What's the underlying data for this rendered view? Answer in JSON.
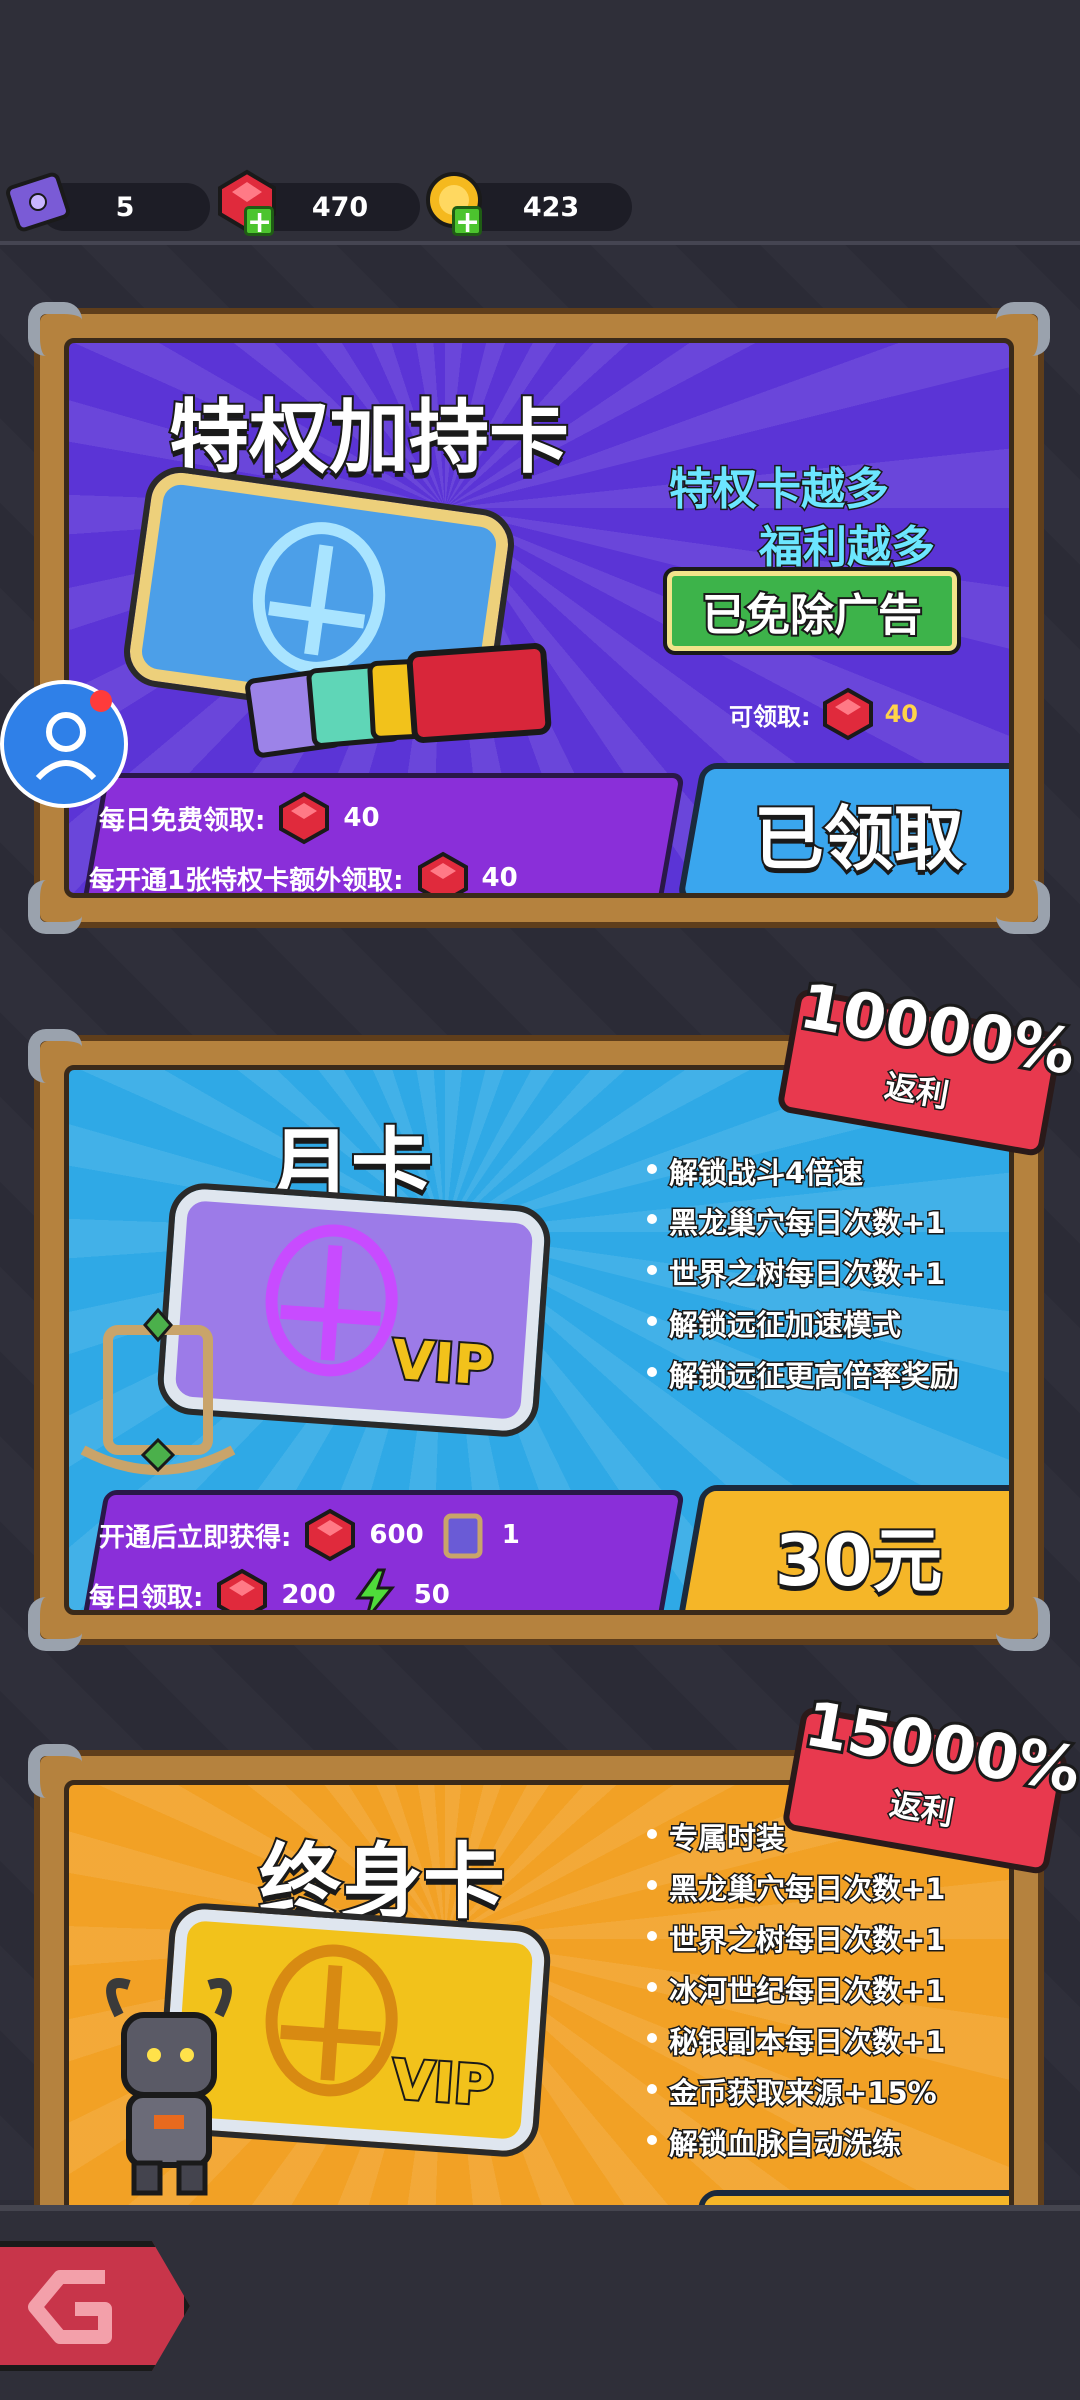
{
  "currency": {
    "tickets": "5",
    "gems": "470",
    "coins": "423"
  },
  "privilege_card": {
    "title": "特权加持卡",
    "slogan_line1": "特权卡越多",
    "slogan_line2": "福利越多",
    "ad_removed": "已免除广告",
    "claimable_label": "可领取:",
    "claimable_value": "40",
    "daily_free_label": "每日免费领取:",
    "daily_free_value": "40",
    "extra_label": "每开通1张特权卡额外领取:",
    "extra_value": "40",
    "button_label": "已领取"
  },
  "monthly_card": {
    "title": "月卡",
    "badge_percent": "10000%",
    "badge_label": "返利",
    "vip_text": "VIP",
    "benefits": [
      "解锁战斗4倍速",
      "黑龙巢穴每日次数+1",
      "世界之树每日次数+1",
      "解锁远征加速模式",
      "解锁远征更高倍率奖励"
    ],
    "instant_label": "开通后立即获得:",
    "instant_gems": "600",
    "instant_frames": "1",
    "daily_label": "每日领取:",
    "daily_gems": "200",
    "daily_energy": "50",
    "price_label": "30元"
  },
  "lifetime_card": {
    "title": "终身卡",
    "badge_percent": "15000%",
    "badge_label": "返利",
    "vip_text": "VIP",
    "benefits": [
      "专属时装",
      "黑龙巢穴每日次数+1",
      "世界之树每日次数+1",
      "冰河世纪每日次数+1",
      "秘银副本每日次数+1",
      "金币获取来源+15%",
      "解锁血脉自动洗练"
    ]
  },
  "colors": {
    "privilege_bg": "#5b34d6",
    "monthly_bg": "#2fa9e6",
    "lifetime_bg": "#f2a125",
    "strip": "#8a2fd9",
    "ribbon": "#e8394e"
  }
}
